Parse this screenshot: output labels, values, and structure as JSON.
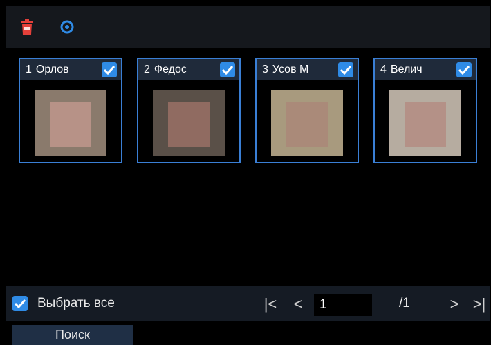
{
  "toolbar": {
    "icons": [
      "trash-icon",
      "gear-icon"
    ],
    "colors": {
      "trash": "#e4403a",
      "gear": "#2f8be6"
    }
  },
  "cards": [
    {
      "number": "1",
      "name": "Орлов",
      "checked": true
    },
    {
      "number": "2",
      "name": "Федос",
      "checked": true
    },
    {
      "number": "3",
      "name": "Усов М",
      "checked": true
    },
    {
      "number": "4",
      "name": "Велич",
      "checked": true
    }
  ],
  "footer": {
    "select_all_label": "Выбрать все",
    "select_all_checked": true,
    "first_page": "|<",
    "prev_page": "<",
    "page_value": "1",
    "page_total": "/1",
    "next_page": ">",
    "last_page": ">|",
    "search_label": "Поиск"
  },
  "colors": {
    "accent": "#2f8be6",
    "card_border": "#3a7fd5"
  }
}
